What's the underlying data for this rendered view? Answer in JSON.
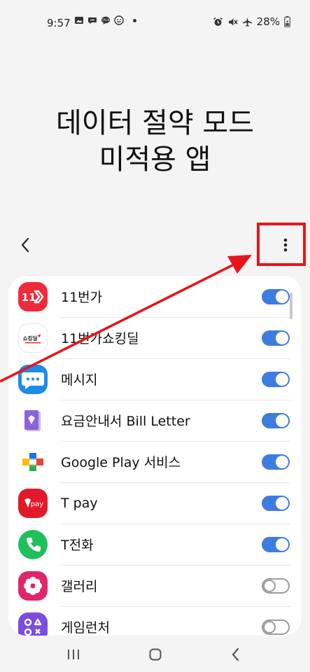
{
  "status_bar": {
    "time": "9:57",
    "battery": "28%",
    "left_icons": [
      "gallery-icon",
      "chat-bubble-icon",
      "talk-icon",
      "smiley-icon"
    ],
    "right_icons": [
      "alarm-icon",
      "mute-icon",
      "airplane-icon",
      "battery-icon"
    ]
  },
  "header": {
    "title_line1": "데이터 절약 모드",
    "title_line2": "미적용 앱"
  },
  "toolbar": {
    "back_icon": "chevron-left-icon",
    "more_icon": "more-vertical-icon"
  },
  "apps": [
    {
      "name": "11번가",
      "enabled": true,
      "icon": "11st-icon",
      "icon_text": "11",
      "color": "#ee2a3b"
    },
    {
      "name": "11번가쇼킹딜",
      "enabled": true,
      "icon": "shocking-deal-icon",
      "icon_text": "쇼킹딜",
      "color": "#ffffff"
    },
    {
      "name": "메시지",
      "enabled": true,
      "icon": "messages-icon",
      "icon_text": "",
      "color": "#1e8be8"
    },
    {
      "name": "요금안내서 Bill Letter",
      "enabled": true,
      "icon": "bill-letter-icon",
      "icon_text": "",
      "color": "#8a63d8"
    },
    {
      "name": "Google Play 서비스",
      "enabled": true,
      "icon": "google-play-services-icon",
      "icon_text": "",
      "color": "#ffffff"
    },
    {
      "name": "T pay",
      "enabled": true,
      "icon": "tpay-icon",
      "icon_text": "pay",
      "color": "#e11a2b"
    },
    {
      "name": "T전화",
      "enabled": true,
      "icon": "phone-icon",
      "icon_text": "",
      "color": "#1fbf5a"
    },
    {
      "name": "갤러리",
      "enabled": false,
      "icon": "gallery-flower-icon",
      "icon_text": "",
      "color": "#e0266a"
    },
    {
      "name": "게임런처",
      "enabled": false,
      "icon": "game-launcher-icon",
      "icon_text": "",
      "color": "#7a4de0"
    }
  ],
  "colors": {
    "toggle_on": "#3e7ce0",
    "highlight": "#e8141b",
    "background": "#f4f4f4"
  },
  "nav_bar": {
    "recents_icon": "recents-icon",
    "home_icon": "home-icon",
    "back_icon": "nav-back-icon"
  }
}
